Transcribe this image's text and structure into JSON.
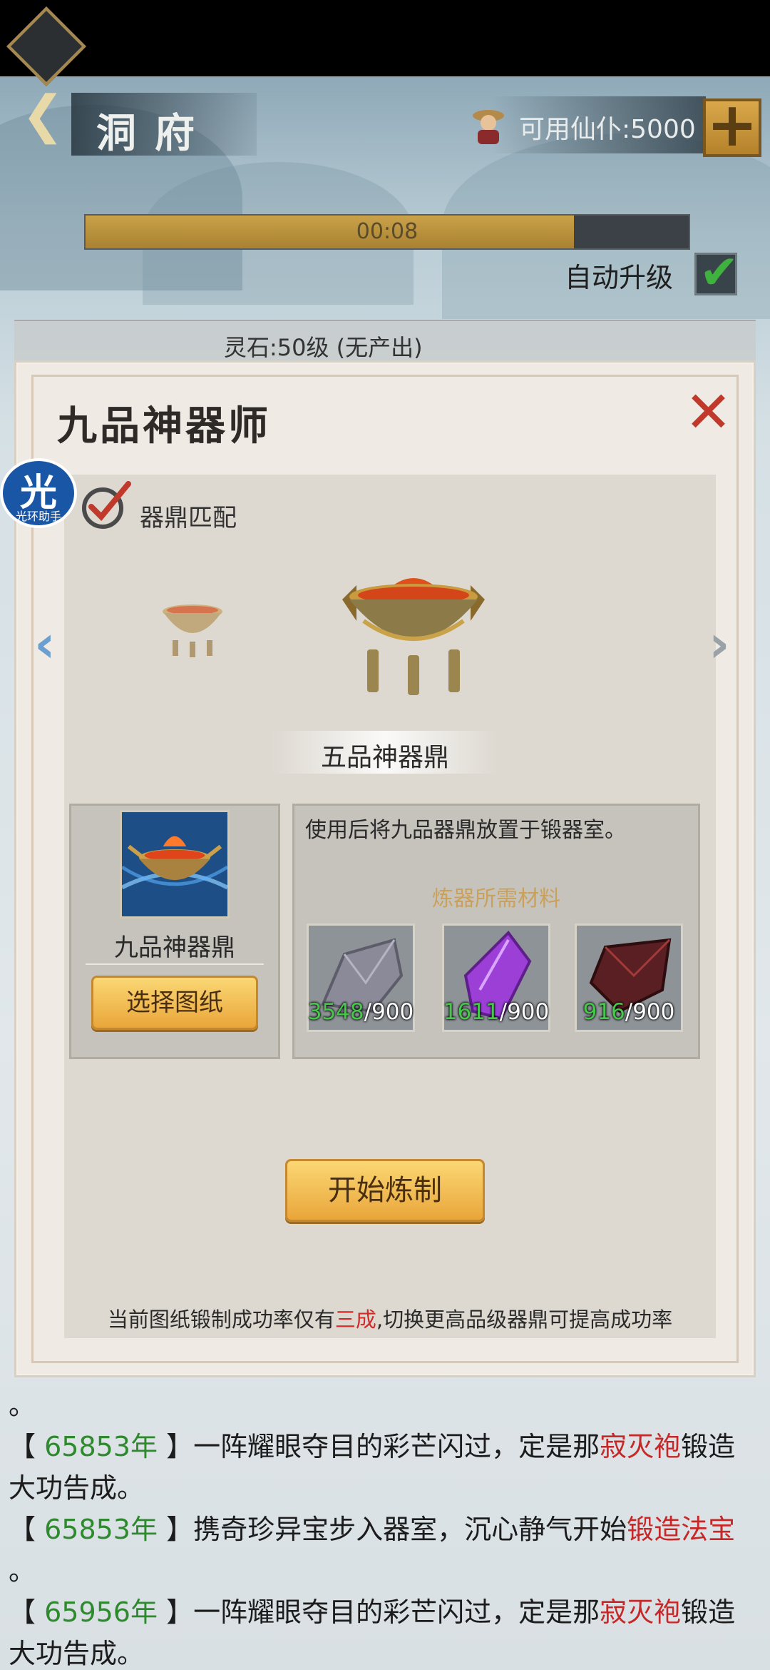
{
  "header": {
    "title": "洞府",
    "resource_text": "可用仙仆:5000",
    "plus_label": "+"
  },
  "progress": {
    "time_text": "00:08",
    "fill_fraction": 0.81
  },
  "auto_upgrade": {
    "label": "自动升级",
    "checked": true
  },
  "behind_panel": {
    "text": "灵石:50级 (无产出)"
  },
  "helper": {
    "char": "光",
    "text": "光环助手"
  },
  "dialog": {
    "title": "九品神器师",
    "close_icon": "close-icon",
    "match_label": "器鼎匹配",
    "selected_cauldron": "五品神器鼎",
    "blueprint": {
      "name": "九品神器鼎",
      "select_button": "选择图纸"
    },
    "use_description": "使用后将九品器鼎放置于锻器室。",
    "materials_title": "炼器所需材料",
    "materials": [
      {
        "icon": "gray-ore-icon",
        "have": "3548",
        "need": "/900",
        "color": "#8b8a99"
      },
      {
        "icon": "purple-crystal-icon",
        "have": "1611",
        "need": "/900",
        "color": "#9b3fd6"
      },
      {
        "icon": "red-ore-icon",
        "have": "916",
        "need": "/900",
        "color": "#5a1f22"
      }
    ],
    "start_button": "开始炼制",
    "hint": {
      "before": "当前图纸锻制成功率仅有",
      "highlight": "三成",
      "after": ",切换更高品级器鼎可提高成功率"
    }
  },
  "log": [
    {
      "id": "l0",
      "parts": [
        {
          "t": "。",
          "c": ""
        }
      ]
    },
    {
      "id": "l1",
      "parts": [
        {
          "t": "【 ",
          "c": ""
        },
        {
          "t": "65853年",
          "c": "yr"
        },
        {
          "t": " 】一阵耀眼夺目的彩芒闪过，定是那",
          "c": ""
        },
        {
          "t": "寂灭袍",
          "c": "red"
        },
        {
          "t": "锻造",
          "c": ""
        }
      ]
    },
    {
      "id": "l2",
      "parts": [
        {
          "t": "大功告成。",
          "c": ""
        }
      ]
    },
    {
      "id": "l3",
      "parts": [
        {
          "t": "【 ",
          "c": ""
        },
        {
          "t": "65853年",
          "c": "yr"
        },
        {
          "t": " 】携奇珍异宝步入器室，沉心静气开始",
          "c": ""
        },
        {
          "t": "锻造法宝",
          "c": "red"
        }
      ]
    },
    {
      "id": "l4",
      "parts": [
        {
          "t": "。",
          "c": ""
        }
      ]
    },
    {
      "id": "l5",
      "parts": [
        {
          "t": "【 ",
          "c": ""
        },
        {
          "t": "65956年",
          "c": "yr"
        },
        {
          "t": " 】一阵耀眼夺目的彩芒闪过，定是那",
          "c": ""
        },
        {
          "t": "寂灭袍",
          "c": "red"
        },
        {
          "t": "锻造",
          "c": ""
        }
      ]
    },
    {
      "id": "l6",
      "parts": [
        {
          "t": "大功告成。",
          "c": ""
        }
      ]
    }
  ]
}
